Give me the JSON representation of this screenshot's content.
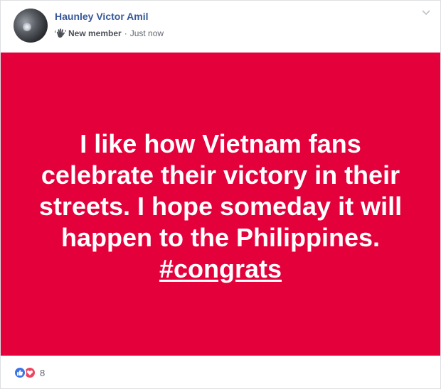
{
  "post": {
    "author": "Haunley Victor Amil",
    "badge": "New member",
    "separator": "·",
    "time": "Just now",
    "avatar_icon": "profile-photo",
    "badge_icon": "waving-hand-icon",
    "menu_icon": "chevron-down-icon",
    "background_color": "#e3003b",
    "text_color": "#ffffff",
    "body_lines": [
      "I like how Vietnam fans",
      "celebrate their victory in their",
      "streets. I hope someday it will",
      "happen to the Philippines."
    ],
    "hashtag": "#congrats"
  },
  "reactions": {
    "icons": [
      "like-icon",
      "love-icon"
    ],
    "count": "8"
  }
}
